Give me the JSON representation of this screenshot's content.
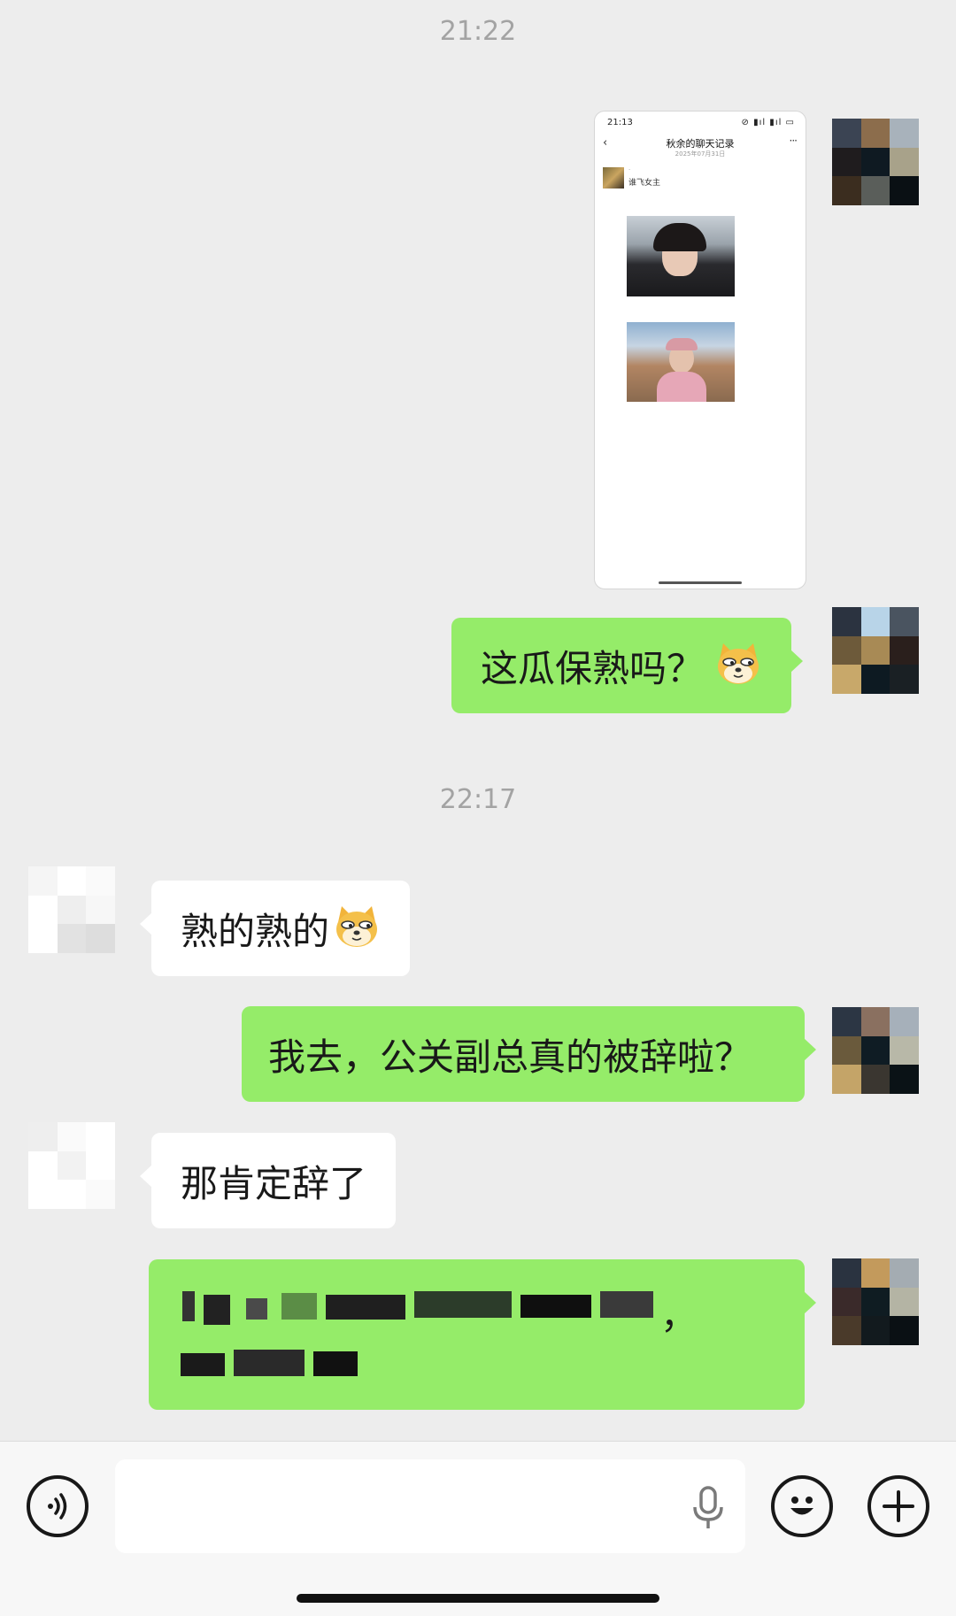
{
  "timestamps": [
    "21:22",
    "22:17"
  ],
  "screenshot_preview": {
    "status_time": "21:13",
    "status_icons": "⊘ ▮ıl ▮ıl ▭",
    "title": "秋余的聊天记录",
    "date": "2025年07月31日",
    "first_message": "谁飞女主"
  },
  "messages": [
    {
      "side": "me",
      "text": "这瓜保熟吗？"
    },
    {
      "side": "them",
      "text": "熟的熟的"
    },
    {
      "side": "me",
      "text": "我去，公关副总真的被辞啦？"
    },
    {
      "side": "them",
      "text": "那肯定辞了"
    },
    {
      "side": "me",
      "text": "，",
      "obscured": true
    }
  ],
  "colors": {
    "background": "#ededed",
    "my_bubble": "#95ec69",
    "their_bubble": "#ffffff",
    "timestamp": "#a3a3a3"
  },
  "input_bar": {
    "icons": [
      "voice-icon",
      "microphone-icon",
      "emoji-icon",
      "plus-icon"
    ]
  }
}
